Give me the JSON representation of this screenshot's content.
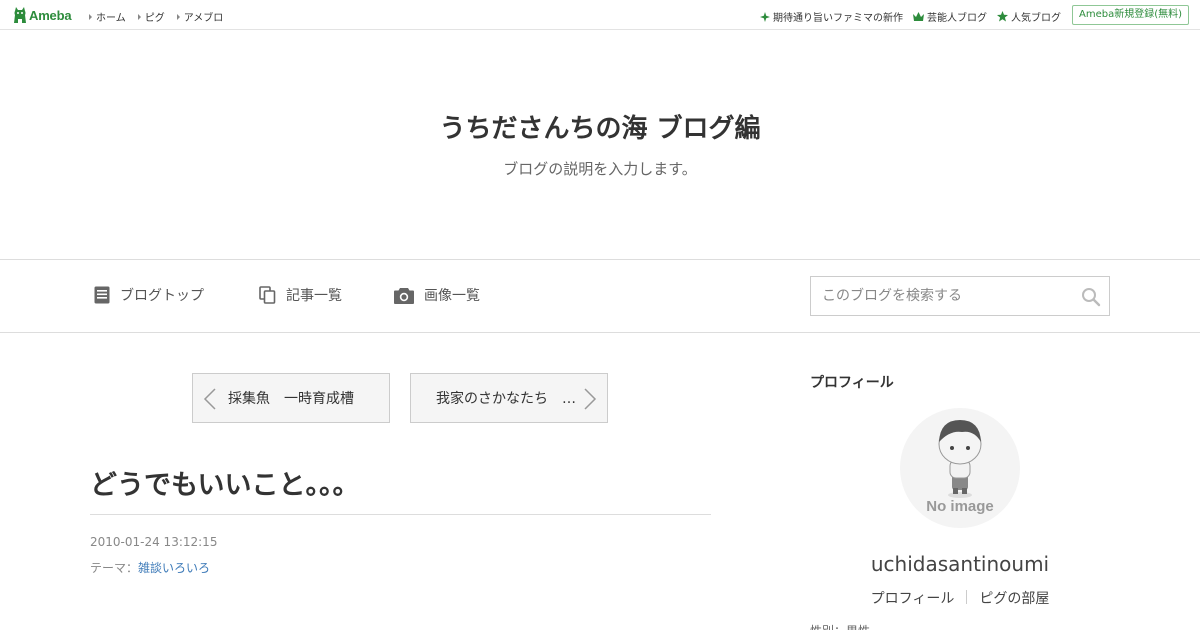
{
  "topbar": {
    "logo_text": "Ameba",
    "left_links": [
      {
        "label": "ホーム"
      },
      {
        "label": "ピグ"
      },
      {
        "label": "アメブロ"
      }
    ],
    "right_links": [
      {
        "label": "期待通り旨いファミマの新作",
        "icon": "sparkle-icon"
      },
      {
        "label": "芸能人ブログ",
        "icon": "crown-icon"
      },
      {
        "label": "人気ブログ",
        "icon": "star-icon"
      }
    ],
    "signup_label": "Ameba新規登録(無料)"
  },
  "header": {
    "title": "うちださんちの海 ブログ編",
    "description": "ブログの説明を入力します。"
  },
  "nav": {
    "items": [
      {
        "label": "ブログトップ",
        "icon": "document-icon"
      },
      {
        "label": "記事一覧",
        "icon": "copy-icon"
      },
      {
        "label": "画像一覧",
        "icon": "camera-icon"
      }
    ],
    "search_placeholder": "このブログを検索する"
  },
  "pager": {
    "prev_label": "採集魚　一時育成槽",
    "next_label": "我家のさかなたち　…"
  },
  "entry": {
    "title": "どうでもいいこと。。。",
    "date": "2010-01-24 13:12:15",
    "theme_prefix": "テーマ：",
    "theme_label": "雑談いろいろ"
  },
  "sidebar": {
    "heading": "プロフィール",
    "avatar_caption": "No image",
    "username": "uchidasantinoumi",
    "links": [
      {
        "label": "プロフィール"
      },
      {
        "label": "ピグの部屋"
      }
    ],
    "cut_text": "性別：男性"
  },
  "colors": {
    "ameba_green": "#2d8c3c",
    "link_blue": "#3d7ab8",
    "border_gray": "#dddddd"
  }
}
